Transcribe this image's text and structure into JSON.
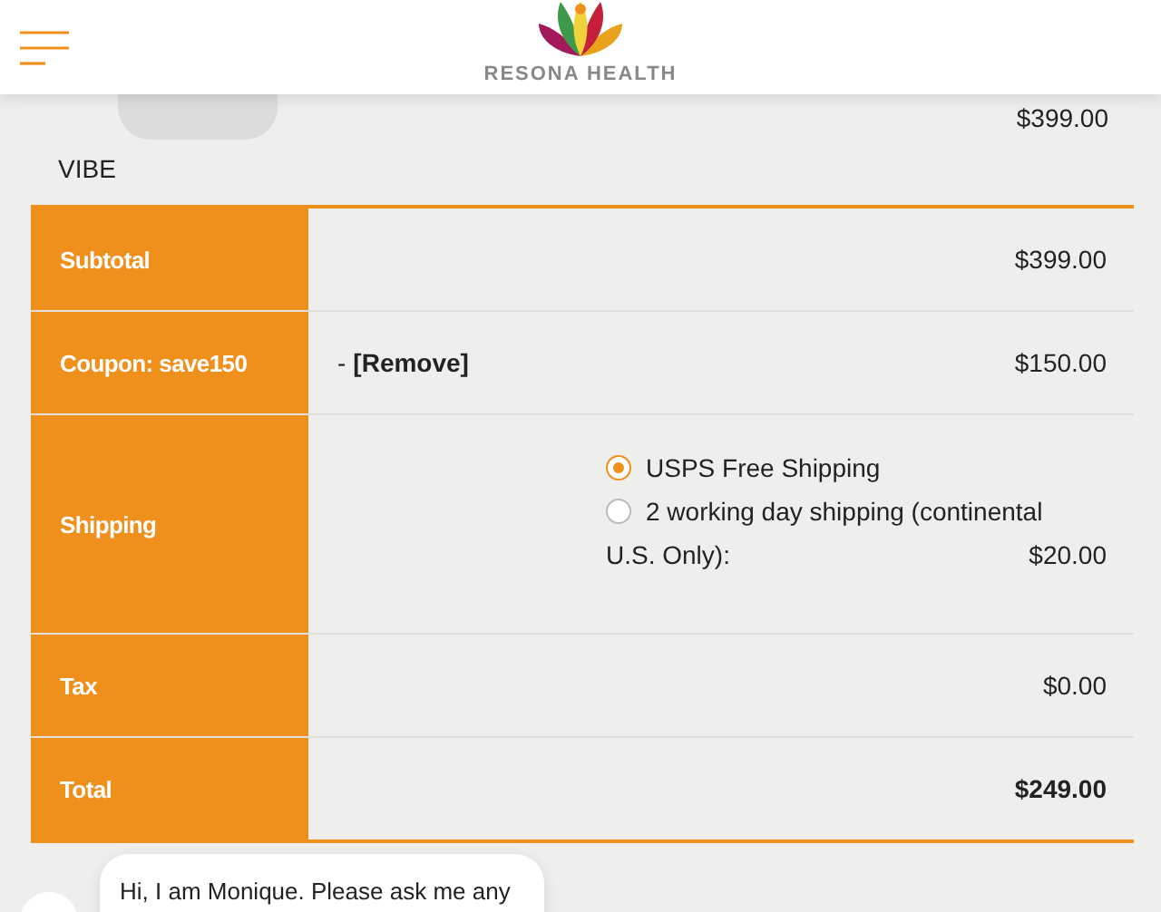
{
  "header": {
    "brand": "RESONA HEALTH"
  },
  "product": {
    "name": "VIBE",
    "price": "$399.00"
  },
  "totals": [
    {
      "label": "Subtotal",
      "kind": "amount",
      "value": "$399.00"
    },
    {
      "label": "Coupon: save150",
      "kind": "coupon",
      "prefix": "-",
      "action": "[Remove]",
      "value": "$150.00"
    },
    {
      "label": "Shipping",
      "kind": "shipping",
      "options": [
        {
          "label": "USPS Free Shipping",
          "selected": true
        },
        {
          "label": "2 working day shipping (continental",
          "selected": false
        }
      ],
      "note": "U.S. Only):",
      "note_price": "$20.00"
    },
    {
      "label": "Tax",
      "kind": "amount",
      "value": "$0.00"
    },
    {
      "label": "Total",
      "kind": "total",
      "value": "$249.00"
    }
  ],
  "chat": {
    "message": "Hi, I am Monique. Please ask me any"
  }
}
